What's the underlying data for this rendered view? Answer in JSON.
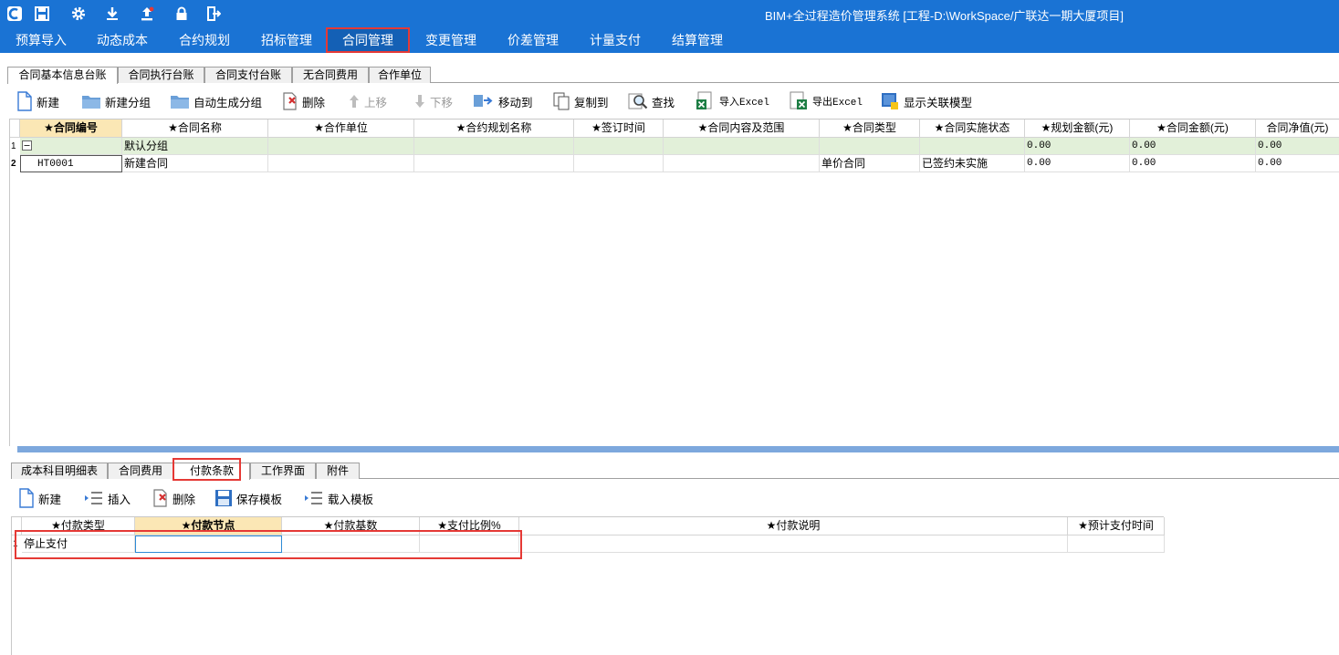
{
  "app": {
    "title": "BIM+全过程造价管理系统 [工程-D:\\WorkSpace/广联达一期大厦项目]",
    "logo_icon": "app-logo-icon",
    "quick_icons": [
      "save-icon",
      "gear-icon",
      "download-icon",
      "upload-icon",
      "lock-icon",
      "exit-icon"
    ]
  },
  "menu": {
    "items": [
      {
        "label": "预算导入"
      },
      {
        "label": "动态成本"
      },
      {
        "label": "合约规划"
      },
      {
        "label": "招标管理"
      },
      {
        "label": "合同管理"
      },
      {
        "label": "变更管理"
      },
      {
        "label": "价差管理"
      },
      {
        "label": "计量支付"
      },
      {
        "label": "结算管理"
      }
    ],
    "active": "合同管理"
  },
  "top_tabs": [
    "合同基本信息台账",
    "合同执行台账",
    "合同支付台账",
    "无合同费用",
    "合作单位"
  ],
  "top_toolbar": [
    {
      "label": "新建",
      "icon": "new-doc-icon"
    },
    {
      "label": "新建分组",
      "icon": "folder-icon"
    },
    {
      "label": "自动生成分组",
      "icon": "folder-icon"
    },
    {
      "label": "删除",
      "icon": "delete-icon"
    },
    {
      "label": "上移",
      "icon": "move-up-icon",
      "disabled": true
    },
    {
      "label": "下移",
      "icon": "move-down-icon",
      "disabled": true
    },
    {
      "label": "移动到",
      "icon": "move-to-icon"
    },
    {
      "label": "复制到",
      "icon": "copy-to-icon"
    },
    {
      "label": "查找",
      "icon": "find-icon"
    },
    {
      "label": "导入Excel",
      "icon": "excel-import-icon"
    },
    {
      "label": "导出Excel",
      "icon": "excel-export-icon"
    },
    {
      "label": "显示关联模型",
      "icon": "model-icon"
    }
  ],
  "contract_table": {
    "columns": [
      "★合同编号",
      "★合同名称",
      "★合作单位",
      "★合约规划名称",
      "★签订时间",
      "★合同内容及范围",
      "★合同类型",
      "★合同实施状态",
      "★规划金额(元)",
      "★合同金额(元)",
      "合同净值(元)"
    ],
    "rows": [
      {
        "num": "1",
        "group": true,
        "cells": [
          "",
          "默认分组",
          "",
          "",
          "",
          "",
          "",
          "",
          "0.00",
          "0.00",
          "0.00"
        ]
      },
      {
        "num": "2",
        "group": false,
        "cells": [
          "HT0001",
          "新建合同",
          "",
          "",
          "",
          "",
          "单价合同",
          "已签约未实施",
          "0.00",
          "0.00",
          "0.00"
        ]
      }
    ]
  },
  "bottom_tabs": [
    "成本科目明细表",
    "合同费用",
    "付款条款",
    "工作界面",
    "附件"
  ],
  "bottom_active_tab": "付款条款",
  "bottom_toolbar": [
    {
      "label": "新建",
      "icon": "new-doc-icon"
    },
    {
      "label": "插入",
      "icon": "insert-icon"
    },
    {
      "label": "删除",
      "icon": "delete-icon"
    },
    {
      "label": "保存模板",
      "icon": "save-template-icon"
    },
    {
      "label": "载入模板",
      "icon": "load-template-icon"
    }
  ],
  "payment_table": {
    "columns": [
      "★付款类型",
      "★付款节点",
      "★付款基数",
      "★支付比例%",
      "★付款说明",
      "★预计支付时间"
    ],
    "rows": [
      {
        "num": "1",
        "cells": [
          "停止支付",
          "",
          "",
          "",
          "",
          ""
        ]
      }
    ]
  },
  "colors": {
    "title_bar": "#1a73d4",
    "highlight_red": "#e53935",
    "group_row": "#e2f0d9",
    "selected_header": "#fbe7b5"
  }
}
